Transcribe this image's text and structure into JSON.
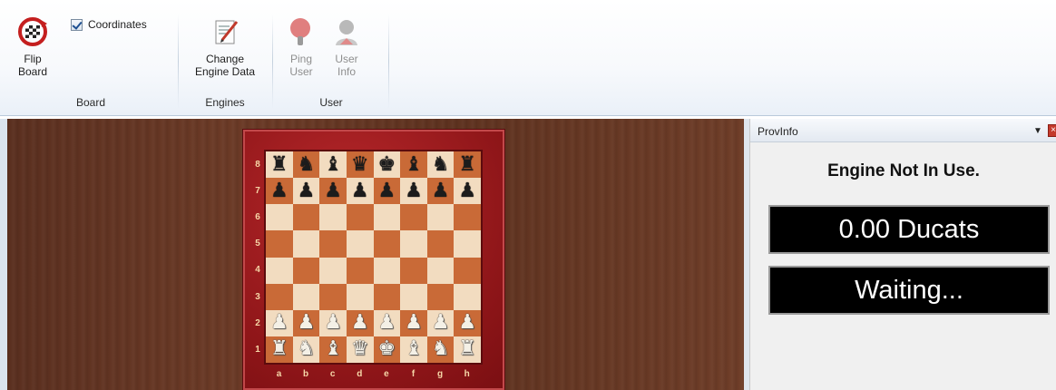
{
  "ribbon": {
    "board_group": {
      "label": "Board",
      "flip_board_label": "Flip\nBoard",
      "coordinates_label": "Coordinates",
      "coordinates_checked": true
    },
    "engines_group": {
      "label": "Engines",
      "change_engine_label": "Change\nEngine Data"
    },
    "user_group": {
      "label": "User",
      "ping_user_label": "Ping\nUser",
      "user_info_label": "User\nInfo"
    }
  },
  "board": {
    "ranks": [
      "8",
      "7",
      "6",
      "5",
      "4",
      "3",
      "2",
      "1"
    ],
    "files": [
      "a",
      "b",
      "c",
      "d",
      "e",
      "f",
      "g",
      "h"
    ],
    "position": [
      [
        "bR",
        "bN",
        "bB",
        "bQ",
        "bK",
        "bB",
        "bN",
        "bR"
      ],
      [
        "bP",
        "bP",
        "bP",
        "bP",
        "bP",
        "bP",
        "bP",
        "bP"
      ],
      [
        "",
        "",
        "",
        "",
        "",
        "",
        "",
        ""
      ],
      [
        "",
        "",
        "",
        "",
        "",
        "",
        "",
        ""
      ],
      [
        "",
        "",
        "",
        "",
        "",
        "",
        "",
        ""
      ],
      [
        "",
        "",
        "",
        "",
        "",
        "",
        "",
        ""
      ],
      [
        "wP",
        "wP",
        "wP",
        "wP",
        "wP",
        "wP",
        "wP",
        "wP"
      ],
      [
        "wR",
        "wN",
        "wB",
        "wQ",
        "wK",
        "wB",
        "wN",
        "wR"
      ]
    ]
  },
  "panel": {
    "title": "ProvInfo",
    "engine_status": "Engine Not In Use.",
    "ducats": "0.00 Ducats",
    "status": "Waiting..."
  },
  "colors": {
    "light_square": "#f2dcc0",
    "dark_square": "#c96a37",
    "frame": "#9b1b1e",
    "lcd_background": "#000000"
  }
}
